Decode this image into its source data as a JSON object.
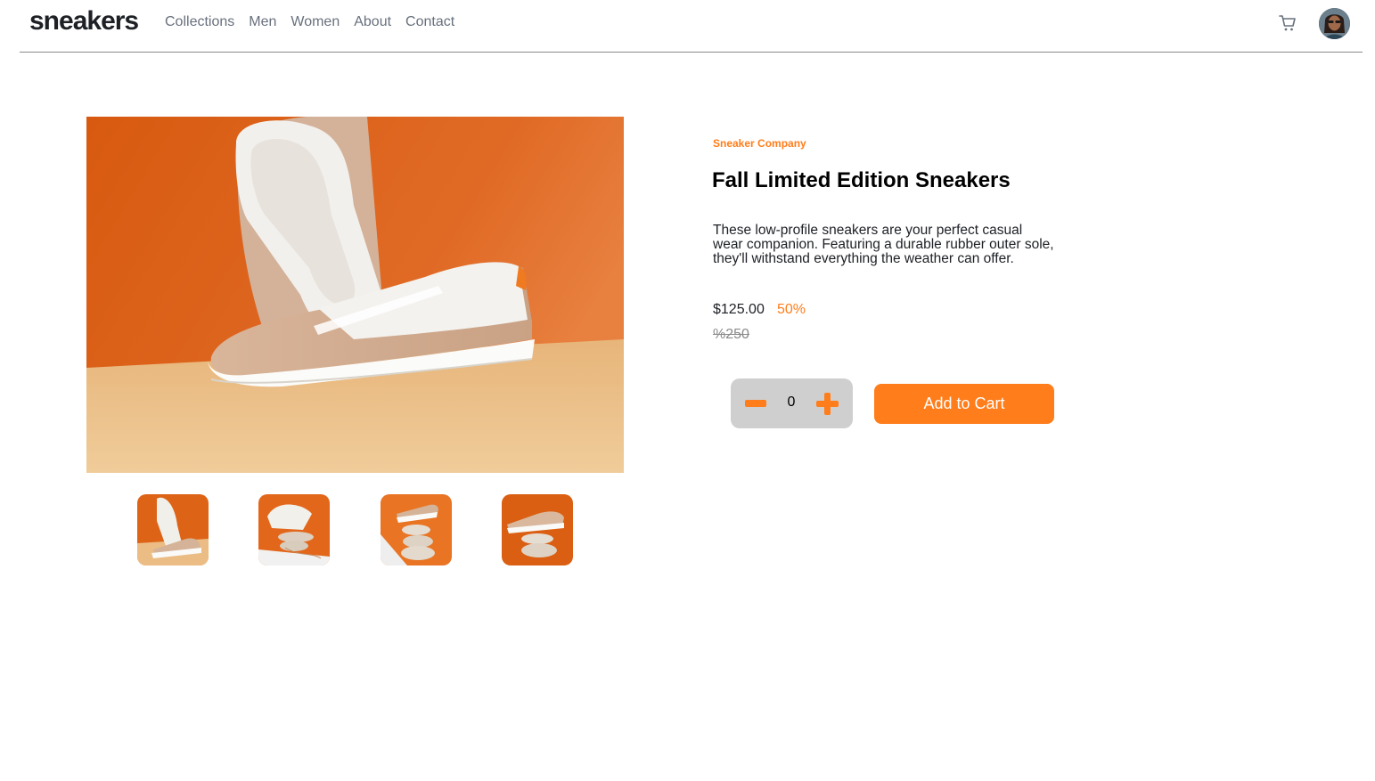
{
  "header": {
    "logo": "sneakers",
    "nav": [
      "Collections",
      "Men",
      "Women",
      "About",
      "Contact"
    ],
    "cart_icon": "cart-icon",
    "avatar_icon": "avatar"
  },
  "product": {
    "company": "Sneaker Company",
    "title": "Fall Limited Edition Sneakers",
    "description": "These low-profile sneakers are your perfect casual wear companion. Featuring a durable rubber outer sole, they'll withstand everything the weather can offer.",
    "price": "$125.00",
    "discount": "50%",
    "old_price": "%250",
    "quantity": "0",
    "add_to_cart": "Add to Cart"
  },
  "colors": {
    "accent": "#ff7d1a",
    "text_dark": "#1d2025",
    "text_muted": "#69707d",
    "qty_bg": "#cfcfcf"
  },
  "gallery": {
    "main_image_icon": "sneaker-photo",
    "thumbnails": [
      "thumbnail-1",
      "thumbnail-2",
      "thumbnail-3",
      "thumbnail-4"
    ]
  }
}
